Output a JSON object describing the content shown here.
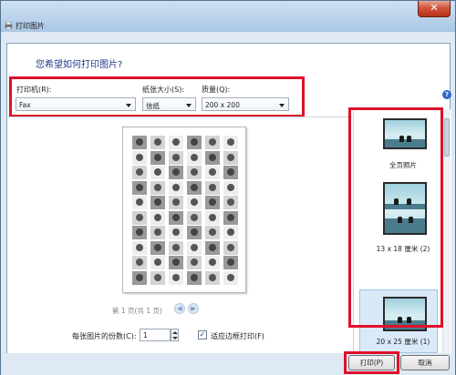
{
  "window": {
    "title": "打印图片",
    "close_label": "✕"
  },
  "heading": "您希望如何打印图片?",
  "printer": {
    "label": "打印机(R):",
    "value": "Fax"
  },
  "paper": {
    "label": "纸张大小(S):",
    "value": "信纸"
  },
  "quality": {
    "label": "质量(Q):",
    "value": "200 x 200"
  },
  "help_label": "?",
  "preview": {
    "page_status": "第 1 页(共 1 页)"
  },
  "options": {
    "copies_label": "每张图片的份数(C):",
    "copies_value": "1",
    "fit_label": "适应边框打印(F)",
    "fit_checked": "✓"
  },
  "layouts": [
    {
      "label": "全页照片"
    },
    {
      "label": "13 x 18 厘米 (2)"
    },
    {
      "label": "20 x 25 厘米 (1)"
    }
  ],
  "footer": {
    "print_label": "打印(P)",
    "cancel_label": "取消"
  },
  "colors": {
    "highlight_box": "#e0102a",
    "heading": "#1e3a8a"
  }
}
